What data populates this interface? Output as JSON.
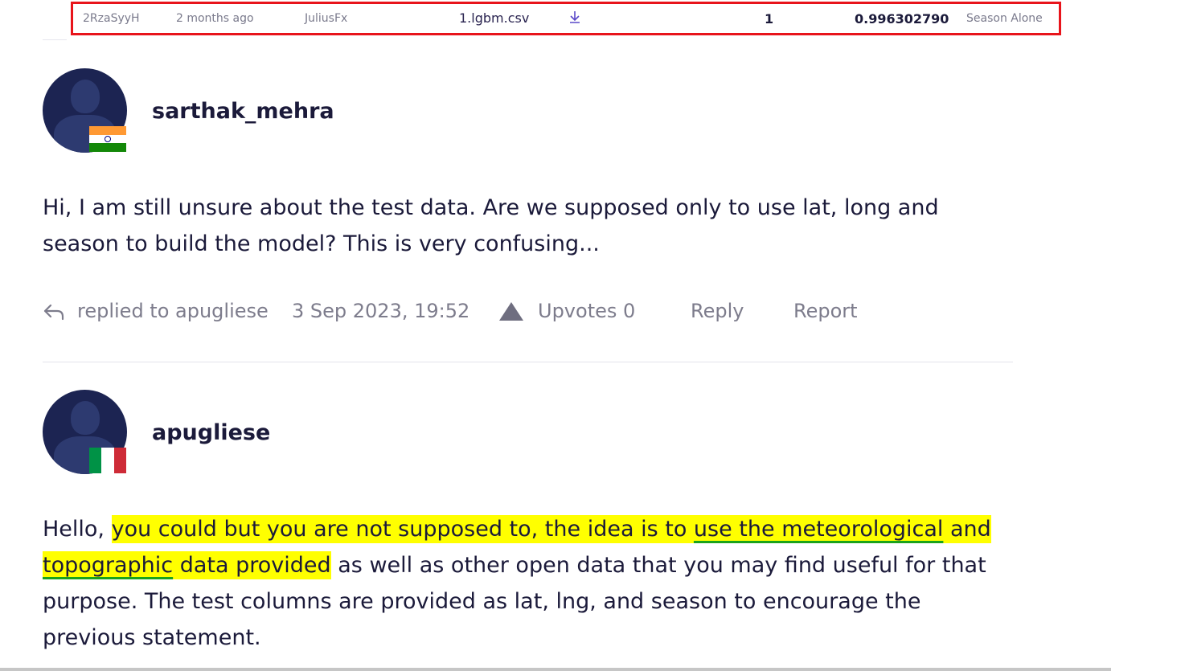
{
  "submission": {
    "id": "2RzaSyyH",
    "time": "2 months ago",
    "user": "JuliusFx",
    "file": "1.lgbm.csv",
    "download_icon": "download-icon",
    "rank": "1",
    "score": "0.996302790",
    "comment": "Season Alone",
    "highlight_color": "#e8141b"
  },
  "comments": [
    {
      "username": "sarthak_mehra",
      "flag": "india",
      "text": "Hi, I am still unsure about the test data. Are we supposed only to use lat, long and season to build the model? This is very confusing...",
      "reply_context": "replied to apugliese",
      "timestamp": "3 Sep 2023, 19:52",
      "upvotes": "Upvotes 0",
      "reply_label": "Reply",
      "report_label": "Report"
    },
    {
      "username": "apugliese",
      "flag": "italy",
      "text_parts": {
        "p1": "Hello, ",
        "p2": "you could but you are not supposed to, the idea is to ",
        "p3": "use the meteorological",
        "p4": " and",
        "p5": "topographic",
        "p6": " data provided",
        "p7": " as well as other open data that you may find useful for that purpose. The test columns are provided as lat, lng, and season to encourage the previous statement."
      }
    }
  ],
  "colors": {
    "avatar_bg": "#1c2452",
    "text": "#1b1a3a",
    "highlight": "#ffff00",
    "underline": "#1aa31a"
  }
}
